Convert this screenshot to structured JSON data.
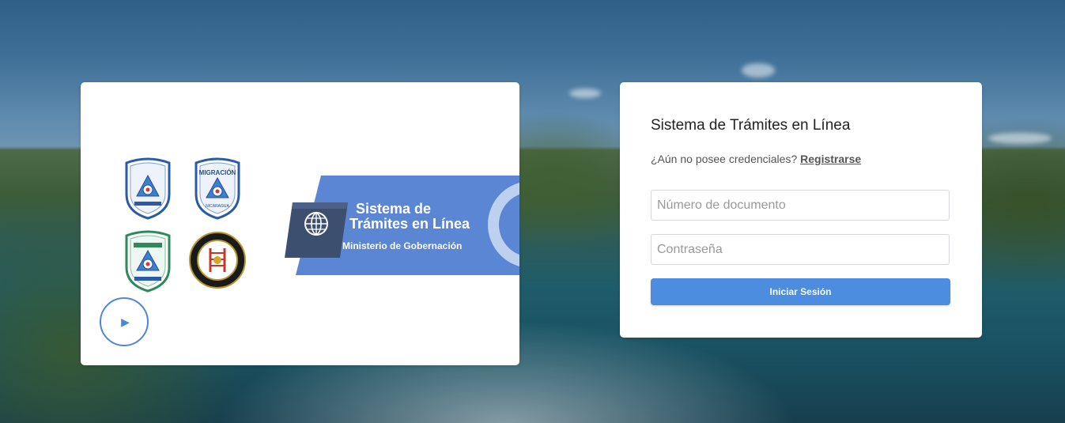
{
  "brand_panel": {
    "banner_title_line1": "Sistema de",
    "banner_title_line2": "Trámites en Línea",
    "banner_subtitle": "Ministerio de Gobernación",
    "badge_migracion_text": "MIGRACIÓN",
    "badge_nicaragua_text": "NICARAGUA",
    "play_icon": "play-icon",
    "globe_icon": "globe-icon"
  },
  "login": {
    "title": "Sistema de Trámites en Línea",
    "register_prompt": "¿Aún no posee credenciales?",
    "register_link": "Registrarse",
    "document_placeholder": "Número de documento",
    "password_placeholder": "Contraseña",
    "submit_label": "Iniciar Sesión"
  },
  "colors": {
    "accent": "#4d8de0",
    "banner_blue": "#5b86d4",
    "banner_dark": "#3d4f6e"
  }
}
